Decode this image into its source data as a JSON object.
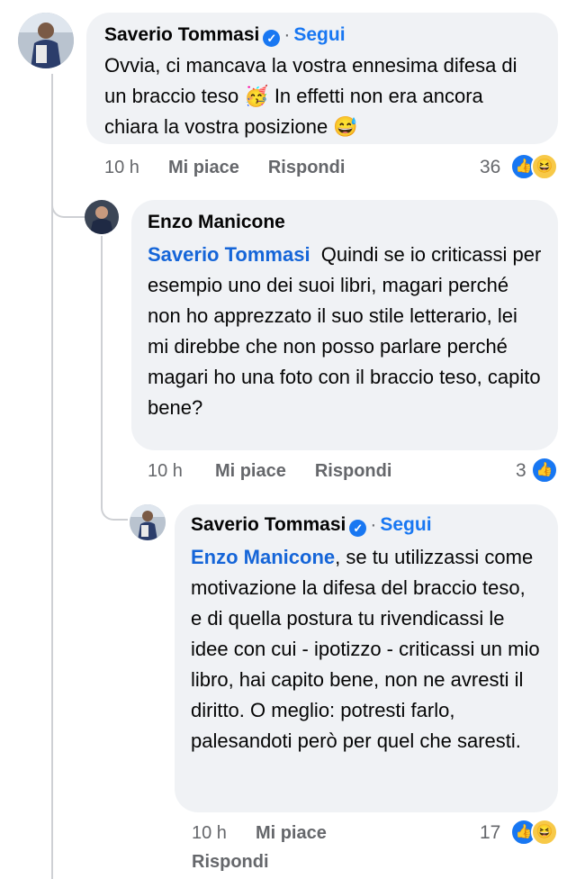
{
  "comments": [
    {
      "author": "Saverio Tommasi",
      "verified": true,
      "follow_label": "Segui",
      "text": "Ovvia, ci mancava la vostra ennesima difesa di un braccio teso 🥳 In effetti non era ancora chiara la vostra posizione 😅",
      "time": "10 h",
      "like_label": "Mi piace",
      "reply_label": "Rispondi",
      "reactions_count": "36",
      "reactions": [
        "like-icon",
        "haha-icon"
      ]
    },
    {
      "author": "Enzo Manicone",
      "mention": "Saverio Tommasi",
      "text": "Quindi se io criticassi per esempio uno dei suoi libri, magari perché non ho apprezzato il suo stile letterario, lei mi direbbe che non posso parlare perché magari ho una foto con il braccio teso, capito bene?",
      "time": "10 h",
      "like_label": "Mi piace",
      "reply_label": "Rispondi",
      "reactions_count": "3",
      "reactions": [
        "like-icon"
      ]
    },
    {
      "author": "Saverio Tommasi",
      "verified": true,
      "follow_label": "Segui",
      "mention": "Enzo Manicone",
      "text": ", se tu utilizzassi come motivazione la difesa del braccio teso, e di quella postura tu rivendicassi le idee con cui - ipotizzo - criticassi un mio libro, hai capito bene, non ne avresti il diritto. O meglio: potresti farlo, palesandoti però per quel che saresti.",
      "time": "10 h",
      "like_label": "Mi piace",
      "reply_label": "Rispondi",
      "reactions_count": "17",
      "reactions": [
        "like-icon",
        "haha-icon"
      ]
    }
  ],
  "colors": {
    "bubble": "#f0f2f5",
    "accent": "#1877f2",
    "meta": "#65676b"
  }
}
